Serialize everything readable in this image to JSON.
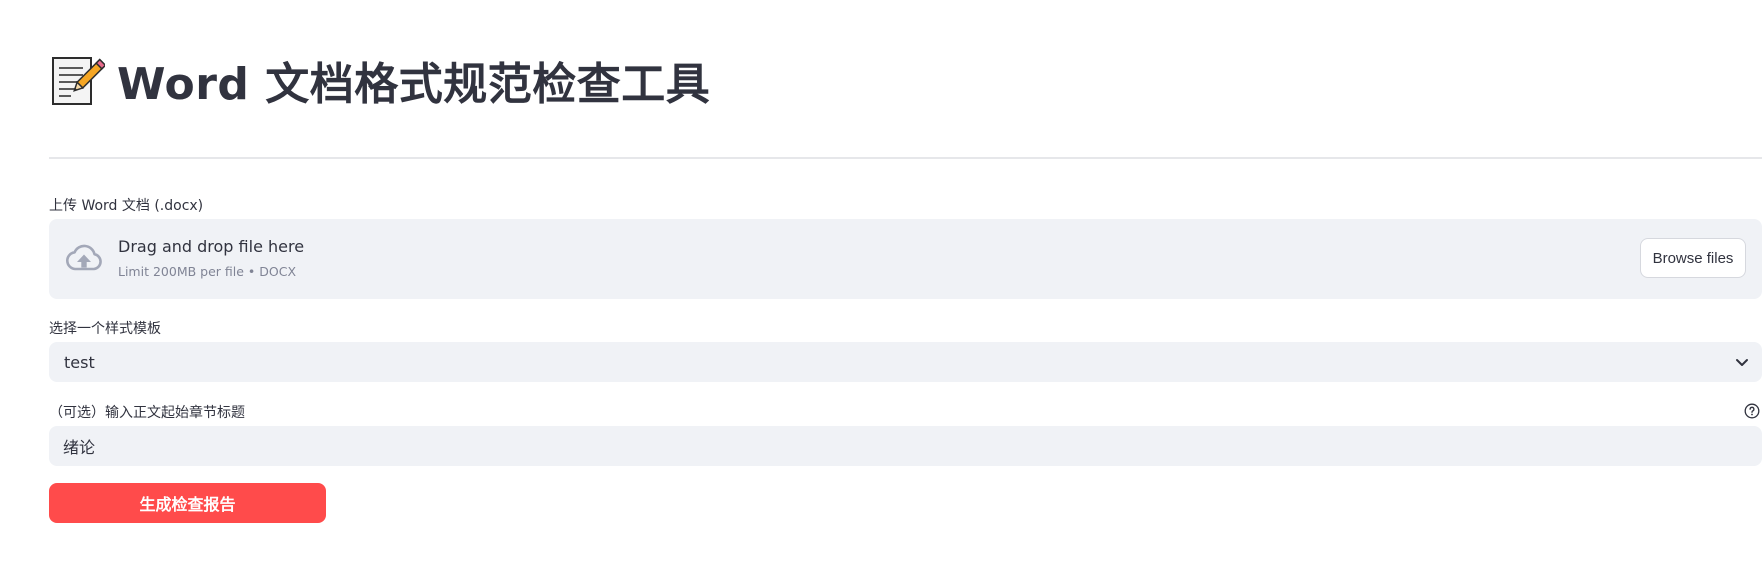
{
  "header": {
    "title": "Word 文档格式规范检查工具",
    "title_icon": "memo-pencil-icon"
  },
  "uploader": {
    "label": "上传 Word 文档 (.docx)",
    "drop_title": "Drag and drop file here",
    "limit_text": "Limit 200MB per file • DOCX",
    "browse_label": "Browse files",
    "icon": "cloud-upload-icon"
  },
  "template_select": {
    "label": "选择一个样式模板",
    "selected": "test",
    "icon": "chevron-down-icon"
  },
  "chapter_input": {
    "label": "（可选）输入正文起始章节标题",
    "value": "绪论",
    "help_icon": "question-circle-icon"
  },
  "actions": {
    "generate_label": "生成检查报告"
  },
  "colors": {
    "primary": "#ff4b4b",
    "input_background": "#f0f2f6",
    "text": "#31333f",
    "muted_text": "#808495"
  }
}
